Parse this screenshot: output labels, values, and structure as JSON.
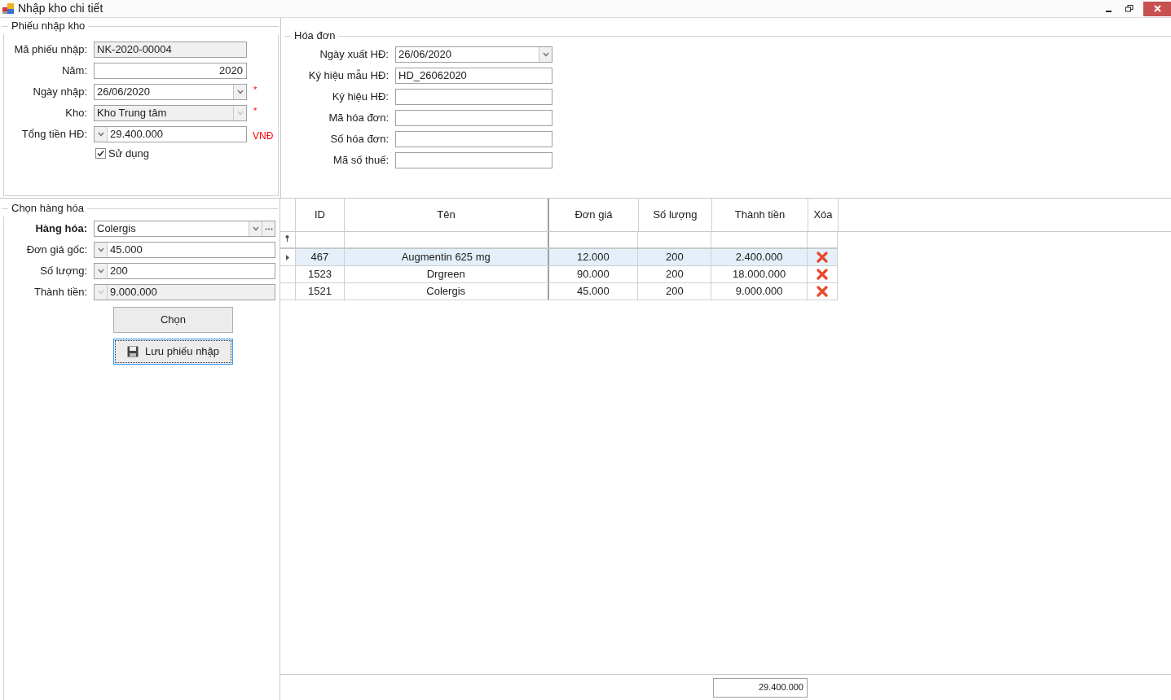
{
  "window": {
    "title": "Nhập kho chi tiết"
  },
  "receipt": {
    "title": "Phiếu nhập kho",
    "fields": [
      {
        "label": "Mã phiếu nhập:",
        "kind": "readonly",
        "value": "NK-2020-00004"
      },
      {
        "label": "Năm:",
        "kind": "number",
        "value": "2020"
      },
      {
        "label": "Ngày nhập:",
        "kind": "date",
        "value": "26/06/2020",
        "mark": "*"
      },
      {
        "label": "Kho:",
        "kind": "combo",
        "value": "Kho Trung tâm",
        "disabled": true,
        "mark": "*"
      },
      {
        "label": "Tổng tiền HĐ:",
        "kind": "spin",
        "value": "29.400.000",
        "disabled": false,
        "suffix": "VNĐ"
      }
    ],
    "checkbox": {
      "label": "Sử dụng",
      "checked": true
    }
  },
  "invoice": {
    "title": "Hóa đơn",
    "fields": [
      {
        "label": "Ngày xuất HĐ:",
        "kind": "date",
        "value": "26/06/2020"
      },
      {
        "label": "Ký hiệu mẫu HĐ:",
        "kind": "text",
        "value": "HD_26062020"
      },
      {
        "label": "Ký hiệu HĐ:",
        "kind": "text"
      },
      {
        "label": "Mã hóa đơn:",
        "kind": "text"
      },
      {
        "label": "Số hóa đơn:",
        "kind": "text"
      },
      {
        "label": "Mã số thuế:",
        "kind": "text"
      }
    ]
  },
  "goods": {
    "title": "Chọn hàng hóa",
    "fields": [
      {
        "label": "Hàng hóa:",
        "kind": "lookup",
        "value": "Colergis"
      },
      {
        "label": "Đơn giá gốc:",
        "kind": "spin",
        "value": "45.000",
        "disabled": false
      },
      {
        "label": "Số lượng:",
        "kind": "spin",
        "value": "200",
        "disabled": false
      },
      {
        "label": "Thành tiền:",
        "kind": "spin",
        "value": "9.000.000",
        "disabled": true
      }
    ],
    "buttons": [
      {
        "label": "Chọn",
        "focused": false
      },
      {
        "label": "Lưu phiếu nhập",
        "focused": true
      }
    ]
  },
  "table": {
    "columns": [
      "ID",
      "Tên",
      "Đơn giá",
      "Số lượng",
      "Thành tiền",
      "Xóa"
    ],
    "rows": [
      {
        "cells": [
          "467",
          "Augmentin 625 mg",
          "12.000",
          "200",
          "2.400.000"
        ],
        "selected": true
      },
      {
        "cells": [
          "1523",
          "Drgreen",
          "90.000",
          "200",
          "18.000.000"
        ],
        "selected": false
      },
      {
        "cells": [
          "1521",
          "Colergis",
          "45.000",
          "200",
          "9.000.000"
        ],
        "selected": false
      }
    ],
    "footer_total": "29.400.000"
  }
}
